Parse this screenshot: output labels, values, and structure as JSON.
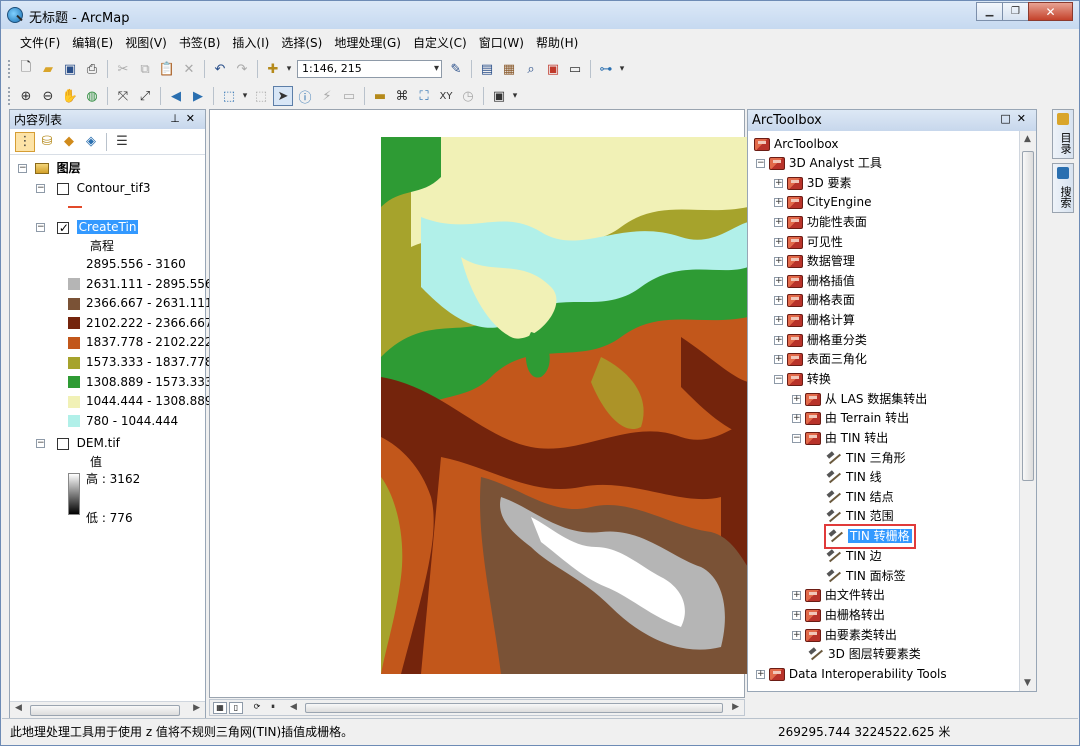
{
  "window": {
    "title": "无标题 - ArcMap"
  },
  "menu": [
    "文件(F)",
    "编辑(E)",
    "视图(V)",
    "书签(B)",
    "插入(I)",
    "选择(S)",
    "地理处理(G)",
    "自定义(C)",
    "窗口(W)",
    "帮助(H)"
  ],
  "toolbar": {
    "scale": "1:146, 215"
  },
  "toc": {
    "title": "内容列表",
    "root": "图层",
    "layers": {
      "contour": {
        "name": "Contour_tif3",
        "checked": false
      },
      "tin": {
        "name": "CreateTin",
        "checked": true,
        "field": "高程",
        "classes": [
          {
            "label": "2895.556 - 3160",
            "color": "#ffffff"
          },
          {
            "label": "2631.111 - 2895.556",
            "color": "#b5b5b5"
          },
          {
            "label": "2366.667 - 2631.111",
            "color": "#7a5236"
          },
          {
            "label": "2102.222 - 2366.667",
            "color": "#74240c"
          },
          {
            "label": "1837.778 - 2102.222",
            "color": "#c2571b"
          },
          {
            "label": "1573.333 - 1837.778",
            "color": "#a6a32c"
          },
          {
            "label": "1308.889 - 1573.333",
            "color": "#2e9b34"
          },
          {
            "label": "1044.444 - 1308.889",
            "color": "#f1f1b6"
          },
          {
            "label": "780 - 1044.444",
            "color": "#b1f0e9"
          }
        ]
      },
      "dem": {
        "name": "DEM.tif",
        "checked": false,
        "field": "值",
        "high": "高 : 3162",
        "low": "低 : 776"
      }
    }
  },
  "arctoolbox": {
    "title": "ArcToolbox",
    "root": "ArcToolbox",
    "items": {
      "analyst": "3D Analyst 工具",
      "features3d": "3D 要素",
      "cityengine": "CityEngine",
      "functional": "功能性表面",
      "visibility": "可见性",
      "datamgmt": "数据管理",
      "rasterinterp": "栅格插值",
      "rastersurface": "栅格表面",
      "rastercalc": "栅格计算",
      "rasterreclass": "栅格重分类",
      "triangulation": "表面三角化",
      "conversion": "转换",
      "fromlas": "从 LAS 数据集转出",
      "fromterrain": "由 Terrain 转出",
      "fromtin": "由 TIN 转出",
      "tin_triangle": "TIN 三角形",
      "tin_line": "TIN 线",
      "tin_node": "TIN 结点",
      "tin_domain": "TIN 范围",
      "tin_raster": "TIN 转栅格",
      "tin_edge": "TIN 边",
      "tin_tag": "TIN 面标签",
      "fromfile": "由文件转出",
      "fromraster": "由栅格转出",
      "fromfeature": "由要素类转出",
      "layer3d": "3D 图层转要素类",
      "interop": "Data Interoperability Tools"
    }
  },
  "dock": {
    "catalog": "目录",
    "search": "搜索"
  },
  "status": {
    "message": "此地理处理工具用于使用 z 值将不规则三角网(TIN)插值成栅格。",
    "coords": "269295.744  3224522.625 米"
  }
}
